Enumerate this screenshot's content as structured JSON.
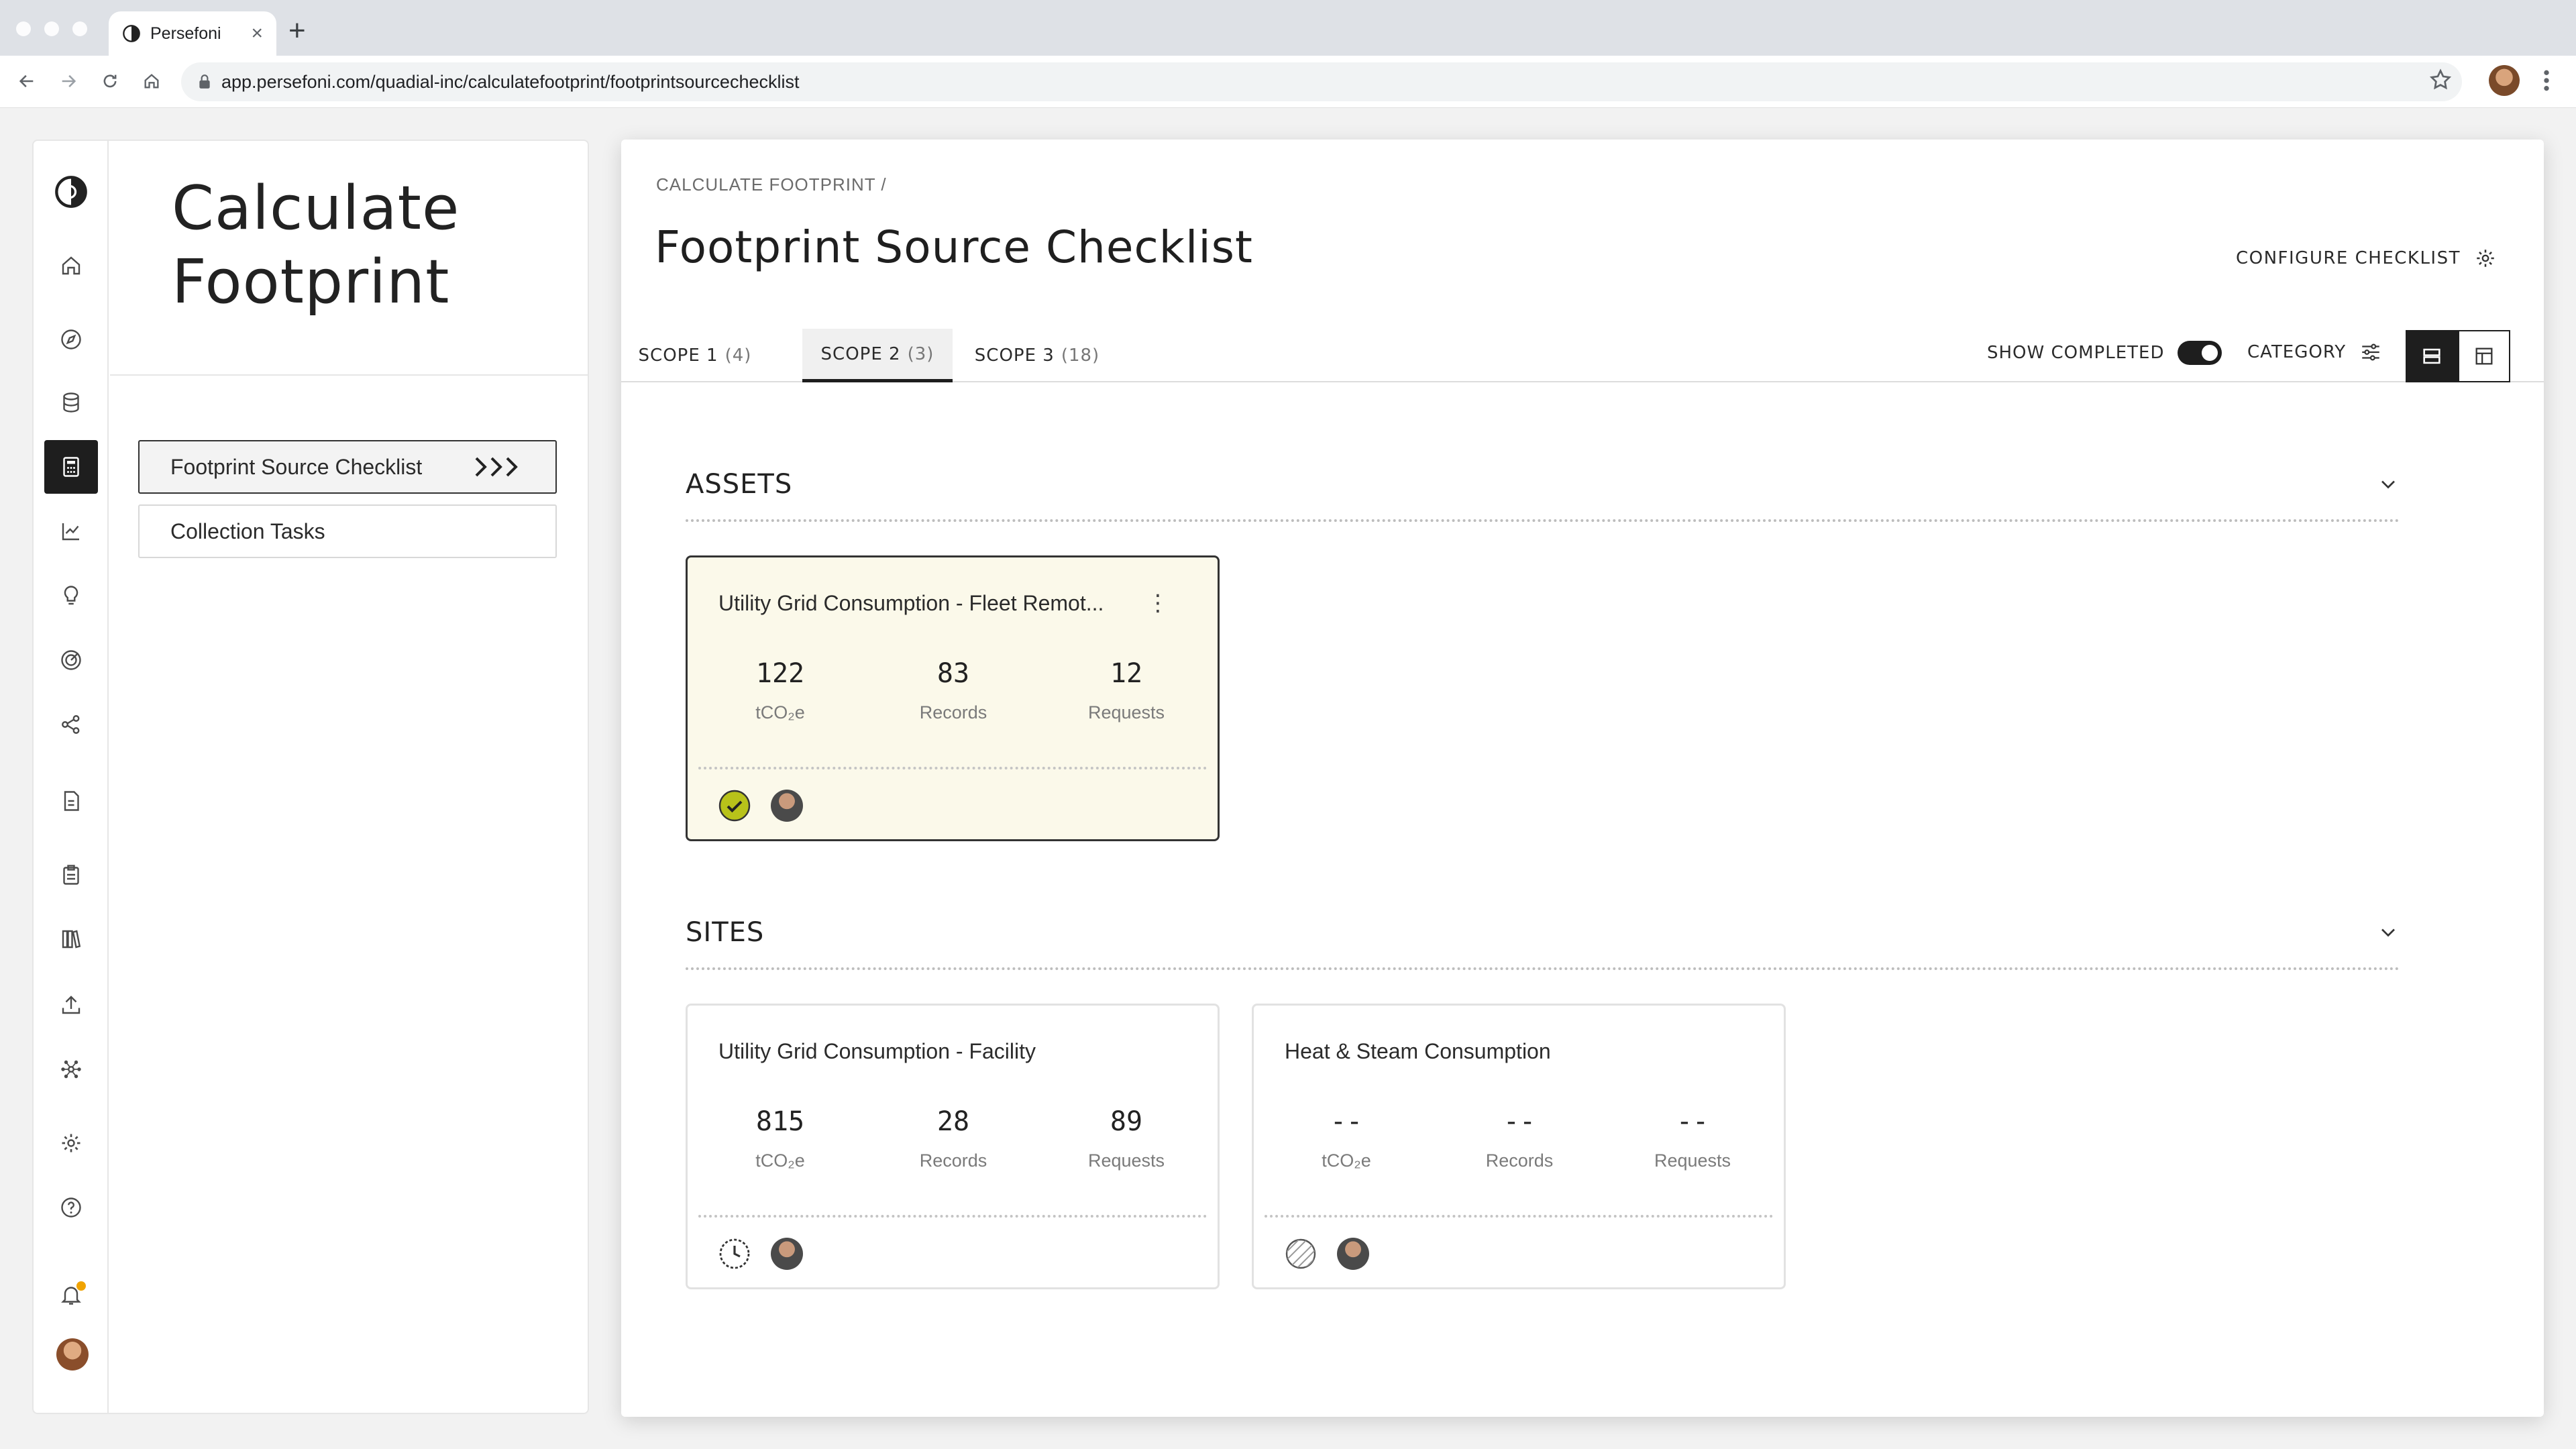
{
  "browser": {
    "tab_title": "Persefoni",
    "tab_close": "×",
    "new_tab": "+",
    "url": "app.persefoni.com/quadial-inc/calculatefootprint/footprintsourcechecklist"
  },
  "sidebar": {
    "page_title_line1": "Calculate",
    "page_title_line2": "Footprint",
    "nav": [
      {
        "label": "Footprint Source Checklist",
        "active": true
      },
      {
        "label": "Collection Tasks",
        "active": false
      }
    ],
    "rail_icons": [
      "logo-icon",
      "home-icon",
      "compass-icon",
      "database-icon",
      "calculator-icon",
      "chart-icon",
      "lightbulb-icon",
      "target-icon",
      "share-icon",
      "report-icon",
      "clipboard-icon",
      "library-icon",
      "upload-icon",
      "network-icon",
      "settings-icon",
      "help-icon",
      "bell-icon"
    ]
  },
  "main": {
    "breadcrumb": "CALCULATE FOOTPRINT /",
    "title": "Footprint Source Checklist",
    "configure_label": "CONFIGURE CHECKLIST",
    "tabs": [
      {
        "label": "SCOPE 1",
        "count": "(4)",
        "active": false
      },
      {
        "label": "SCOPE 2",
        "count": "(3)",
        "active": true
      },
      {
        "label": "SCOPE 3",
        "count": "(18)",
        "active": false
      }
    ],
    "show_completed_label": "SHOW COMPLETED",
    "show_completed_on": true,
    "category_label": "CATEGORY",
    "sections": [
      {
        "heading": "ASSETS",
        "cards": [
          {
            "title": "Utility Grid Consumption - Fleet Remot...",
            "menu": "⋮",
            "stats": [
              {
                "value": "122",
                "label": "tCO₂e"
              },
              {
                "value": "83",
                "label": "Records"
              },
              {
                "value": "12",
                "label": "Requests"
              }
            ],
            "status": "completed"
          }
        ]
      },
      {
        "heading": "SITES",
        "cards": [
          {
            "title": "Utility Grid Consumption - Facility",
            "stats": [
              {
                "value": "815",
                "label": "tCO₂e"
              },
              {
                "value": "28",
                "label": "Records"
              },
              {
                "value": "89",
                "label": "Requests"
              }
            ],
            "status": "in-progress"
          },
          {
            "title": "Heat & Steam Consumption",
            "stats": [
              {
                "value": "--",
                "label": "tCO₂e"
              },
              {
                "value": "--",
                "label": "Records"
              },
              {
                "value": "--",
                "label": "Requests"
              }
            ],
            "status": "not-started"
          }
        ]
      }
    ]
  },
  "colors": {
    "accent": "#1e1e1e",
    "completed_badge": "#b8c21a",
    "selected_card_bg": "#fbf9ea",
    "notification_dot": "#f0a300"
  }
}
